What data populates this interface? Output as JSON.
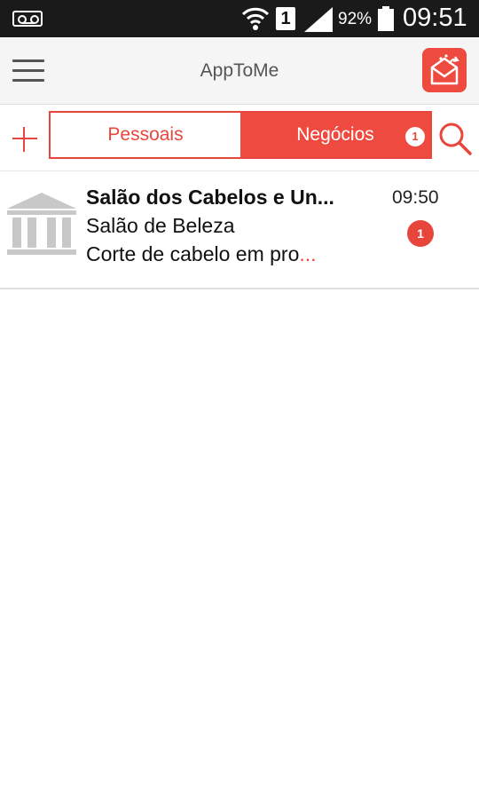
{
  "status_bar": {
    "sim_slot": "1",
    "battery_percent": "92%",
    "time": "09:51",
    "icons": [
      "voicemail-icon",
      "wifi-icon",
      "sim-icon",
      "signal-icon",
      "battery-icon"
    ]
  },
  "app_bar": {
    "title": "AppToMe",
    "icons": [
      "menu-icon",
      "inbox-icon"
    ],
    "accent_color": "#ef4a3f"
  },
  "tabs": {
    "items": [
      {
        "label": "Pessoais",
        "selected": false
      },
      {
        "label": "Negócios",
        "selected": true,
        "badge": "1"
      }
    ]
  },
  "conversations": [
    {
      "title": "Salão dos Cabelos e Un...",
      "subtitle": "Salão de Beleza",
      "preview": "Corte de cabelo em pro",
      "ellipsis": "...",
      "time": "09:50",
      "unread": "1",
      "icon": "bank-icon"
    }
  ]
}
